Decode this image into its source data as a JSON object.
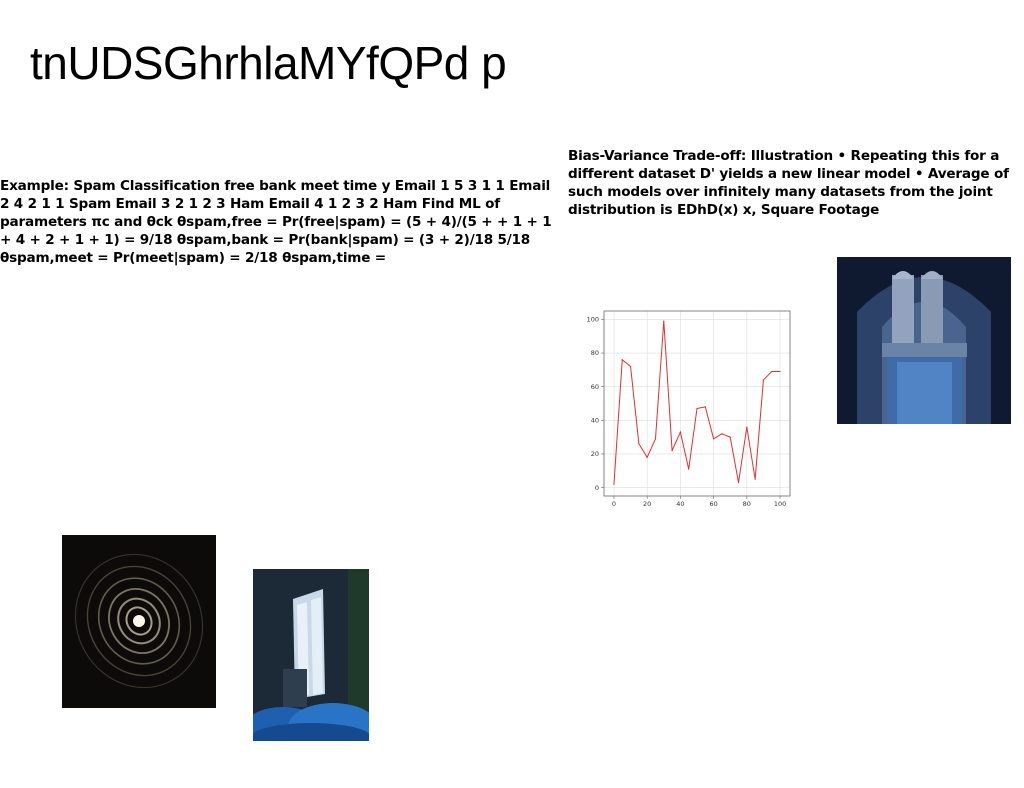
{
  "slide": {
    "title": "tnUDSGhrhlaMYfQPd p",
    "left_text": "Example: Spam Classification free bank meet time y Email 1 5 3 1 1 Email 2 4 2 1 1 Spam Email 3 2 1 2 3 Ham Email 4 1 2 3 2 Ham Find ML of parameters πc and θck θspam,free = Pr(free|spam) = (5 + 4)/(5 + + 1 + 1 + 4 + 2 + 1 + 1) = 9/18 θspam,bank = Pr(bank|spam) = (3 + 2)/18 5/18 θspam,meet = Pr(meet|spam) = 2/18 θspam,time =",
    "right_text": "Bias-Variance Trade-off: Illustration • Repeating this for a different dataset D' yields a new linear model • Average of such models over infinitely many datasets from the joint distribution is EDhD(x) x, Square Footage"
  },
  "chart_data": {
    "type": "line",
    "x": [
      0,
      5,
      10,
      15,
      20,
      25,
      30,
      35,
      40,
      45,
      50,
      55,
      60,
      65,
      70,
      75,
      80,
      85,
      90,
      95,
      100
    ],
    "series": [
      {
        "values": [
          2,
          76,
          72,
          26,
          18,
          29,
          99,
          22,
          33,
          11,
          47,
          48,
          29,
          32,
          30,
          3,
          36,
          5,
          64,
          69,
          69
        ]
      }
    ],
    "xticks": [
      "0",
      "20",
      "40",
      "60",
      "80",
      "100"
    ],
    "yticks": [
      "0",
      "20",
      "40",
      "60",
      "80",
      "100"
    ],
    "xlim": [
      -6,
      106
    ],
    "ylim": [
      -5,
      105
    ],
    "grid": true,
    "line_color": "#e03030",
    "title": "",
    "xlabel": "",
    "ylabel": ""
  }
}
